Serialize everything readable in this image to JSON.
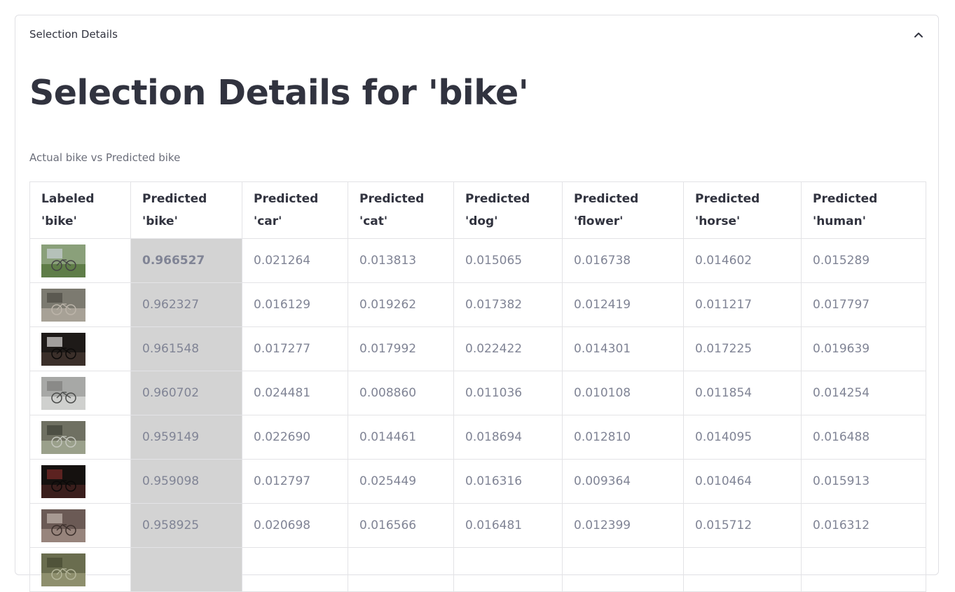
{
  "expander": {
    "title": "Selection Details",
    "icon": "chevron-up-icon"
  },
  "page": {
    "title": "Selection Details for 'bike'",
    "caption": "Actual bike vs Predicted bike"
  },
  "colors": {
    "highlight_bg": "#d3d3d3",
    "text_primary": "#31333f",
    "text_muted": "#808495",
    "border": "#e3e3e6"
  },
  "table": {
    "headers": [
      [
        "Labeled",
        "'bike'"
      ],
      [
        "Predicted",
        "'bike'"
      ],
      [
        "Predicted",
        "'car'"
      ],
      [
        "Predicted",
        "'cat'"
      ],
      [
        "Predicted",
        "'dog'"
      ],
      [
        "Predicted",
        "'flower'"
      ],
      [
        "Predicted",
        "'horse'"
      ],
      [
        "Predicted",
        "'human'"
      ]
    ],
    "rows": [
      {
        "image": "bike-thumbnail",
        "values": [
          "0.966527",
          "0.021264",
          "0.013813",
          "0.015065",
          "0.016738",
          "0.014602",
          "0.015289"
        ]
      },
      {
        "image": "bike-thumbnail",
        "values": [
          "0.962327",
          "0.016129",
          "0.019262",
          "0.017382",
          "0.012419",
          "0.011217",
          "0.017797"
        ]
      },
      {
        "image": "bike-thumbnail",
        "values": [
          "0.961548",
          "0.017277",
          "0.017992",
          "0.022422",
          "0.014301",
          "0.017225",
          "0.019639"
        ]
      },
      {
        "image": "bike-thumbnail",
        "values": [
          "0.960702",
          "0.024481",
          "0.008860",
          "0.011036",
          "0.010108",
          "0.011854",
          "0.014254"
        ]
      },
      {
        "image": "bike-thumbnail",
        "values": [
          "0.959149",
          "0.022690",
          "0.014461",
          "0.018694",
          "0.012810",
          "0.014095",
          "0.016488"
        ]
      },
      {
        "image": "bike-thumbnail",
        "values": [
          "0.959098",
          "0.012797",
          "0.025449",
          "0.016316",
          "0.009364",
          "0.010464",
          "0.015913"
        ]
      },
      {
        "image": "bike-thumbnail",
        "values": [
          "0.958925",
          "0.020698",
          "0.016566",
          "0.016481",
          "0.012399",
          "0.015712",
          "0.016312"
        ]
      },
      {
        "image": "bike-thumbnail",
        "values": [
          "",
          "",
          "",
          "",
          "",
          "",
          ""
        ]
      }
    ]
  }
}
